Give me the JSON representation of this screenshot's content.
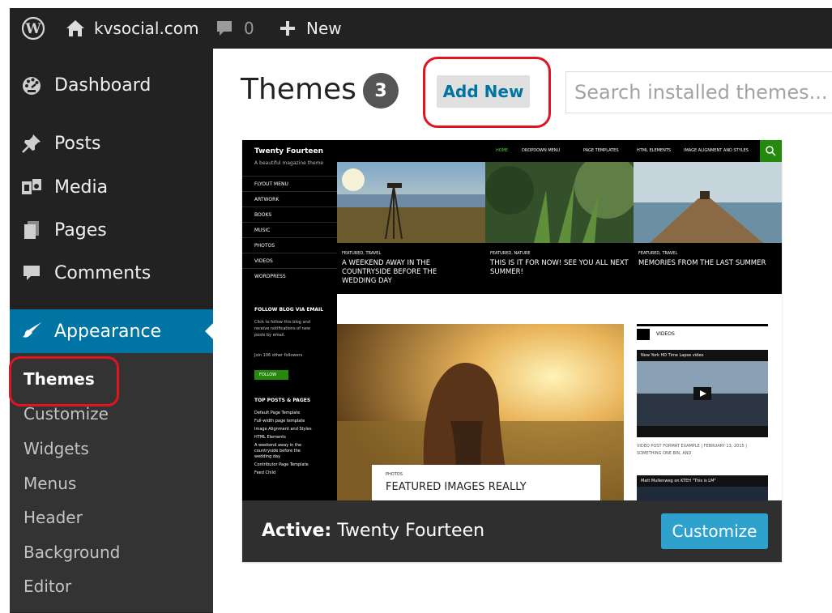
{
  "adminbar": {
    "site_name": "kvsocial.com",
    "comments_count": "0",
    "new_label": "New"
  },
  "sidebar": {
    "items": [
      {
        "label": "Dashboard"
      },
      {
        "label": "Posts"
      },
      {
        "label": "Media"
      },
      {
        "label": "Pages"
      },
      {
        "label": "Comments"
      },
      {
        "label": "Appearance"
      }
    ],
    "submenu": [
      {
        "label": "Themes"
      },
      {
        "label": "Customize"
      },
      {
        "label": "Widgets"
      },
      {
        "label": "Menus"
      },
      {
        "label": "Header"
      },
      {
        "label": "Background"
      },
      {
        "label": "Editor"
      }
    ]
  },
  "main": {
    "title": "Themes",
    "count": "3",
    "add_new_label": "Add New",
    "search_placeholder": "Search installed themes..."
  },
  "theme": {
    "active_prefix": "Active:",
    "active_name": "Twenty Fourteen",
    "customize_label": "Customize",
    "preview": {
      "site_title": "Twenty Fourteen",
      "tagline": "A beautiful magazine theme",
      "top_nav": [
        "HOME",
        "DROPDOWN MENU",
        "PAGE TEMPLATES",
        "HTML ELEMENTS",
        "IMAGE ALIGNMENT AND STYLES"
      ],
      "side_nav": [
        "FLYOUT MENU",
        "ARTWORK",
        "BOOKS",
        "MUSIC",
        "PHOTOS",
        "VIDEOS",
        "WORDPRESS"
      ],
      "follow_heading": "FOLLOW BLOG VIA EMAIL",
      "follow_text_1": "Click to follow this blog and",
      "follow_text_2": "receive notifications of new",
      "follow_text_3": "posts by email.",
      "followers_text": "Join 106 other followers",
      "follow_button": "FOLLOW",
      "top_posts_heading": "TOP POSTS & PAGES",
      "top_posts": [
        "Default Page Template",
        "Full-width page template",
        "Image Alignment and Styles",
        "HTML Elements",
        "A weekend away in the",
        "countryside before the",
        "wedding day",
        "Contributor Page Template",
        "Feed Child"
      ],
      "captions": [
        {
          "category": "FEATURED, TRAVEL",
          "line1": "A WEEKEND AWAY IN THE",
          "line2": "COUNTRYSIDE BEFORE THE",
          "line3": "WEDDING DAY"
        },
        {
          "category": "FEATURED, NATURE",
          "line1": "THIS IS IT FOR NOW! SEE YOU ALL NEXT",
          "line2": "SUMMER!"
        },
        {
          "category": "FEATURED, TRAVEL",
          "line1": "MEMORIES FROM THE LAST SUMMER"
        }
      ],
      "videos_heading": "VIDEOS",
      "video1_title": "New York HD Time Lapse video",
      "video_post_meta_1": "VIDEO POST FORMAT EXAMPLE | FEBRUARY 13, 2015 |",
      "video_post_meta_2": "SOMETHING ONE BIN, AND",
      "video2_title": "Matt Mullenweg on KTEH \"This is LM\"",
      "feature_category": "PHOTOS",
      "feature_title": "FEATURED IMAGES REALLY"
    }
  },
  "colors": {
    "adminbar_bg": "#222222",
    "sidebar_bg": "#222222",
    "submenu_bg": "#333333",
    "accent_blue": "#0074a2",
    "customize_button": "#2ea2cc",
    "annotation_red": "#e0141e",
    "theme_green": "#24890d"
  },
  "icons": {
    "wordpress": "wordpress-logo-icon",
    "site": "home-icon",
    "comments": "comment-bubble-icon",
    "new": "plus-icon",
    "dashboard": "dashboard-gauge-icon",
    "posts": "pushpin-icon",
    "media": "media-icon",
    "pages": "pages-icon",
    "comments_menu": "comment-bubble-icon",
    "appearance": "paintbrush-icon"
  }
}
